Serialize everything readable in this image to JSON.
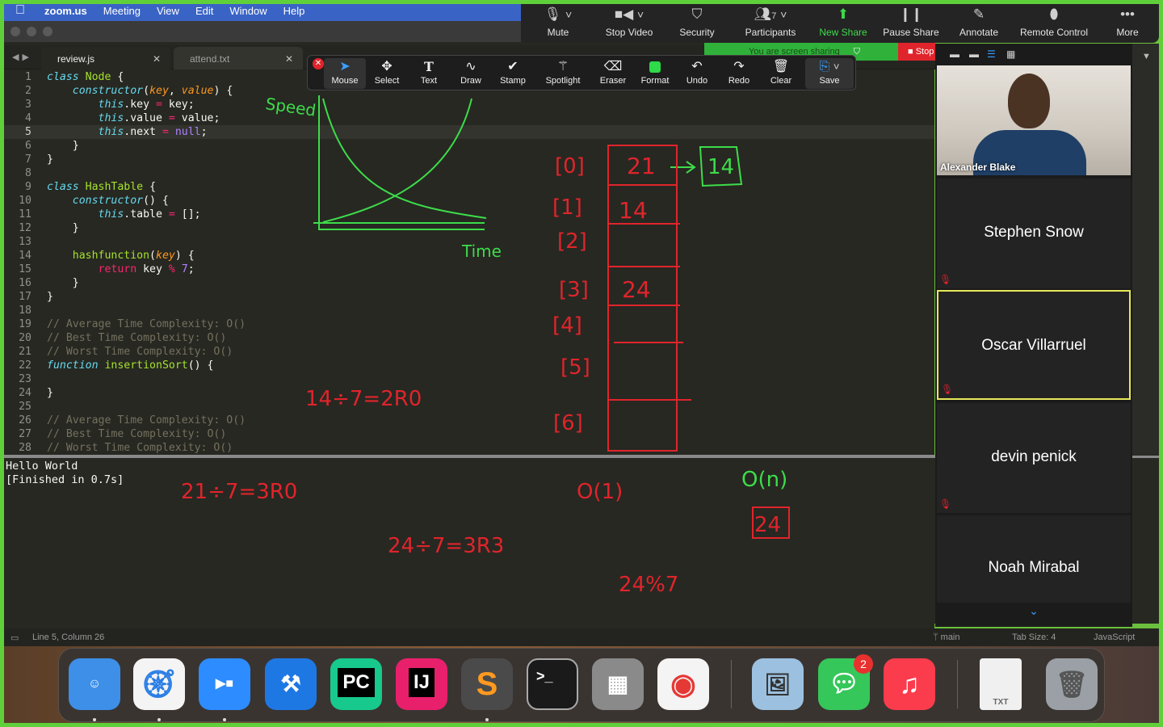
{
  "menubar": {
    "app": "zoom.us",
    "items": [
      "Meeting",
      "View",
      "Edit",
      "Window",
      "Help"
    ]
  },
  "tabs": [
    {
      "label": "review.js",
      "active": true
    },
    {
      "label": "attend.txt",
      "active": false
    }
  ],
  "code_lines": [
    {
      "n": "1",
      "html": "<span class='k'>class</span> <span class='g'>Node</span> {"
    },
    {
      "n": "2",
      "html": "    <span class='k'>constructor</span>(<span class='o'>key</span>, <span class='o'>value</span>) {"
    },
    {
      "n": "3",
      "html": "        <span class='k'>this</span>.key <span class='r'>=</span> key;"
    },
    {
      "n": "4",
      "html": "        <span class='k'>this</span>.value <span class='r'>=</span> value;"
    },
    {
      "n": "5",
      "html": "        <span class='k'>this</span>.next <span class='r'>=</span> <span class='s'>null</span>;",
      "current": true
    },
    {
      "n": "6",
      "html": "    }"
    },
    {
      "n": "7",
      "html": "}"
    },
    {
      "n": "8",
      "html": ""
    },
    {
      "n": "9",
      "html": "<span class='k'>class</span> <span class='g'>HashTable</span> {"
    },
    {
      "n": "10",
      "html": "    <span class='k'>constructor</span>() {"
    },
    {
      "n": "11",
      "html": "        <span class='k'>this</span>.table <span class='r'>=</span> [];"
    },
    {
      "n": "12",
      "html": "    }"
    },
    {
      "n": "13",
      "html": ""
    },
    {
      "n": "14",
      "html": "    <span class='g'>hashfunction</span>(<span class='o'>key</span>) {"
    },
    {
      "n": "15",
      "html": "        <span class='r'>return</span> key <span class='r'>%</span> <span class='s'>7</span>;"
    },
    {
      "n": "16",
      "html": "    }"
    },
    {
      "n": "17",
      "html": "}"
    },
    {
      "n": "18",
      "html": ""
    },
    {
      "n": "19",
      "html": "<span class='c'>// Average Time Complexity: O()</span>"
    },
    {
      "n": "20",
      "html": "<span class='c'>// Best Time Complexity: O()</span>"
    },
    {
      "n": "21",
      "html": "<span class='c'>// Worst Time Complexity: O()</span>"
    },
    {
      "n": "22",
      "html": "<span class='k'>function</span> <span class='g'>insertionSort</span>() {"
    },
    {
      "n": "23",
      "html": ""
    },
    {
      "n": "24",
      "html": "}"
    },
    {
      "n": "25",
      "html": ""
    },
    {
      "n": "26",
      "html": "<span class='c'>// Average Time Complexity: O()</span>"
    },
    {
      "n": "27",
      "html": "<span class='c'>// Best Time Complexity: O()</span>"
    },
    {
      "n": "28",
      "html": "<span class='c'>// Worst Time Complexity: O()</span>"
    }
  ],
  "output": {
    "line1": "Hello World",
    "line2": "[Finished in 0.7s]"
  },
  "statusbar": {
    "position": "Line 5, Column 26",
    "branch": "main",
    "tab_size": "Tab Size: 4",
    "syntax": "JavaScript"
  },
  "zoom_toolbar": {
    "mute": "Mute",
    "stop_video": "Stop Video",
    "security": "Security",
    "participants": "Participants",
    "participants_count": "7",
    "new_share": "New Share",
    "pause_share": "Pause Share",
    "annotate": "Annotate",
    "remote_control": "Remote Control",
    "more": "More",
    "sharing_banner": "You are screen sharing",
    "stop": "Stop"
  },
  "annotate_toolbar": {
    "mouse": "Mouse",
    "select": "Select",
    "text": "Text",
    "draw": "Draw",
    "stamp": "Stamp",
    "spotlight": "Spotlight",
    "eraser": "Eraser",
    "format": "Format",
    "undo": "Undo",
    "redo": "Redo",
    "clear": "Clear",
    "save": "Save"
  },
  "participants": {
    "video_name": "Alexander Blake",
    "tiles": [
      "Stephen Snow",
      "Oscar Villarruel",
      "devin penick",
      "Noah Mirabal"
    ]
  },
  "whiteboard": {
    "speed": "Speed",
    "time": "Time",
    "indices": [
      "[0]",
      "[1]",
      "[2]",
      "[3]",
      "[4]",
      "[5]",
      "[6]"
    ],
    "cells": [
      "21",
      "14",
      "",
      "24",
      "",
      "",
      ""
    ],
    "chained": "14",
    "calc1": "14÷7=2R0",
    "calc2": "21÷7=3R0",
    "calc3": "24÷7=3R3",
    "calc4": "24%7",
    "o1": "O(1)",
    "on": "O(n)",
    "boxed": "24"
  },
  "dock": {
    "messages_badge": "2",
    "txt_label": "TXT",
    "pc_label": "PC",
    "ij_label": "IJ"
  },
  "colors": {
    "ink_red": "#e0242b",
    "ink_green": "#3ddc4a",
    "zoom_blue": "#3aa0ff"
  }
}
